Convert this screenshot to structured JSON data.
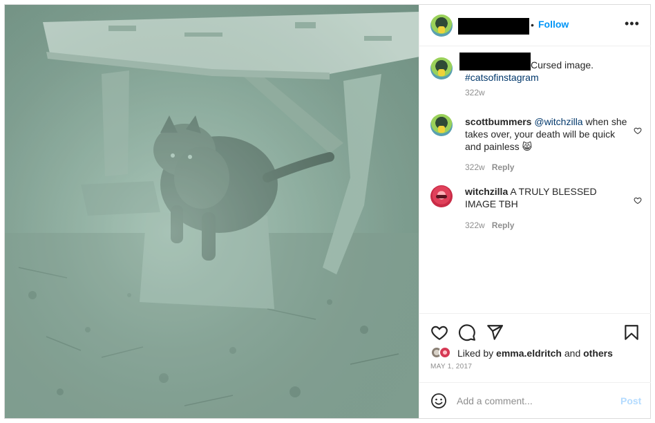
{
  "header": {
    "separator": "•",
    "follow_label": "Follow",
    "more_label": "•••"
  },
  "caption": {
    "text": "Cursed image.",
    "hashtag": "#catsofinstagram",
    "time": "322w"
  },
  "comments": [
    {
      "username": "scottbummers",
      "mention": "@witchzilla",
      "text": " when she takes over, your death will be quick and painless 😸",
      "time": "322w",
      "reply_label": "Reply"
    },
    {
      "username": "witchzilla",
      "text": " A TRULY BLESSED IMAGE TBH",
      "time": "322w",
      "reply_label": "Reply"
    }
  ],
  "likes": {
    "prefix": "Liked by ",
    "user": "emma.eldritch",
    "middle": " and ",
    "others": "others"
  },
  "date": "MAY 1, 2017",
  "add_comment": {
    "placeholder": "Add a comment...",
    "post_label": "Post"
  },
  "icons": {
    "header": [
      "more-icon"
    ],
    "actions": [
      "heart-icon",
      "comment-icon",
      "share-icon",
      "bookmark-icon"
    ],
    "comment": [
      "heart-small-icon",
      "emoji-icon"
    ]
  },
  "colors": {
    "link_blue": "#0095f6",
    "hashtag": "#00376b",
    "muted": "#8e8e8e",
    "post_disabled": "#b3dbff"
  }
}
